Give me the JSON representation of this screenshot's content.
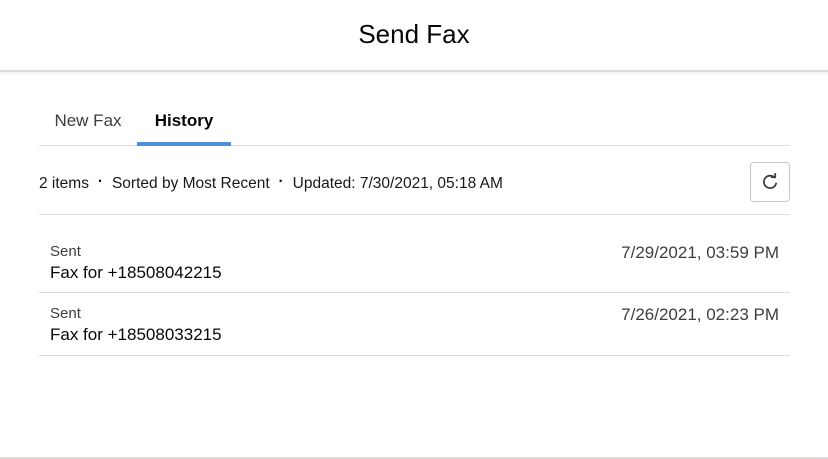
{
  "modal": {
    "title": "Send Fax"
  },
  "tabs": [
    {
      "label": "New Fax",
      "active": false
    },
    {
      "label": "History",
      "active": true
    }
  ],
  "meta": {
    "item_count": "2 items",
    "separator": "·",
    "sort": "Sorted by Most Recent",
    "updated": "Updated: 7/30/2021, 05:18 AM"
  },
  "refresh": {
    "icon": "refresh-icon"
  },
  "history": [
    {
      "status": "Sent",
      "title": "Fax for +18508042215",
      "date": "7/29/2021, 03:59 PM"
    },
    {
      "status": "Sent",
      "title": "Fax for +18508033215",
      "date": "7/26/2021, 02:23 PM"
    }
  ],
  "colors": {
    "active_tab_indicator": "#4a90e2",
    "border": "#dddbda",
    "text": "#181818"
  }
}
